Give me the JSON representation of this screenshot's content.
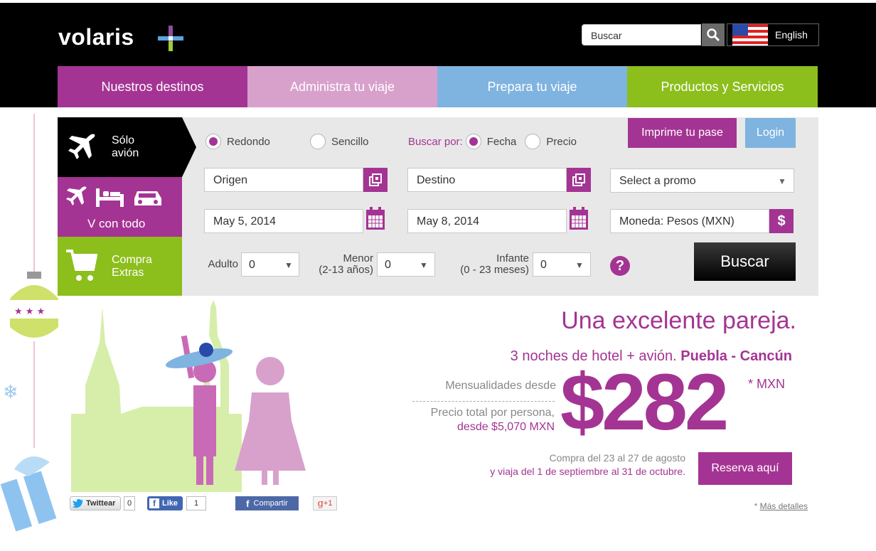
{
  "header": {
    "logo": "volaris",
    "search_placeholder": "Buscar",
    "language_label": "English"
  },
  "nav": [
    "Nuestros destinos",
    "Administra tu viaje",
    "Prepara tu viaje",
    "Productos y Servicios"
  ],
  "sidebar": {
    "solo_avion": [
      "Sólo",
      "avión"
    ],
    "v_con_todo": "V con todo",
    "compra_extras": [
      "Compra",
      "Extras"
    ]
  },
  "booking": {
    "trip_type": {
      "round": "Redondo",
      "oneway": "Sencillo",
      "selected": "Redondo"
    },
    "search_by": {
      "label": "Buscar por:",
      "date": "Fecha",
      "price": "Precio",
      "selected": "Fecha"
    },
    "print_pass": "Imprime tu pase",
    "login": "Login",
    "origin_placeholder": "Origen",
    "destination_placeholder": "Destino",
    "promo_select": "Select a promo",
    "depart_date": "May 5, 2014",
    "return_date": "May 8, 2014",
    "currency": "Moneda: Pesos (MXN)",
    "adult_label": "Adulto",
    "adult_value": "0",
    "minor_label": [
      "Menor",
      "(2-13 años)"
    ],
    "minor_value": "0",
    "infant_label": [
      "Infante",
      "(0 - 23 meses)"
    ],
    "infant_value": "0",
    "help": "?",
    "search_button": "Buscar"
  },
  "promo": {
    "headline": "Una excelente pareja.",
    "subline_prefix": "3 noches de hotel + avión.",
    "subline_route": "Puebla - Cancún",
    "monthly_label": "Mensualidades desde",
    "price": "$282",
    "price_suffix": "* MXN",
    "total_label": "Precio total por persona,",
    "total_value": "desde $5,070 MXN",
    "dates_line1": "Compra del 23 al 27 de agosto",
    "dates_line2": "y viaja del 1 de septiembre al 31 de octubre.",
    "reserve_button": "Reserva aquí",
    "details_star": "*",
    "details_link": "Más detalles"
  },
  "social": {
    "twitter_label": "Twittear",
    "twitter_count": "0",
    "like_label": "Like",
    "like_count": "1",
    "share_label": "Compartir",
    "gplus_label": "+1"
  },
  "colors": {
    "purple": "#a43493",
    "pink": "#d8a1cc",
    "blue": "#7fb3e0",
    "green": "#8cbe1c",
    "illustration_green": "#d6eeaa"
  }
}
